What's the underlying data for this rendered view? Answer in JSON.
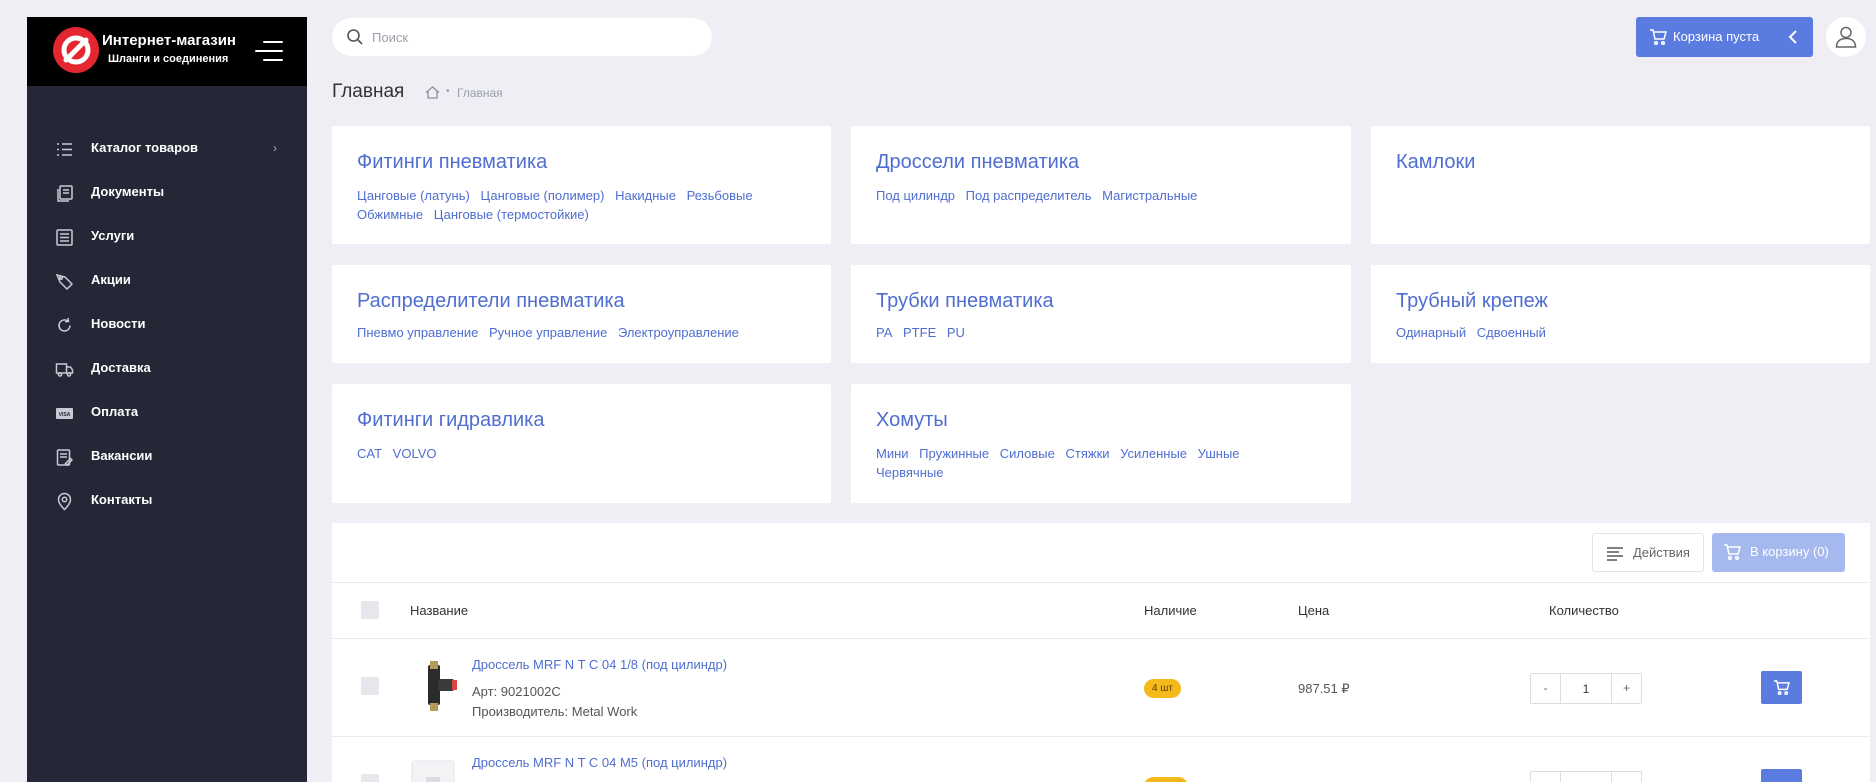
{
  "brand": {
    "title": "Интернет-магазин",
    "subtitle": "Шланги и соединения"
  },
  "nav": [
    {
      "label": "Каталог товаров",
      "icon": "catalog-list-icon"
    },
    {
      "label": "Документы",
      "icon": "documents-icon"
    },
    {
      "label": "Услуги",
      "icon": "services-icon"
    },
    {
      "label": "Акции",
      "icon": "promo-icon"
    },
    {
      "label": "Новости",
      "icon": "news-icon"
    },
    {
      "label": "Доставка",
      "icon": "truck-icon"
    },
    {
      "label": "Оплата",
      "icon": "visa-card-icon"
    },
    {
      "label": "Вакансии",
      "icon": "vacancies-icon"
    },
    {
      "label": "Контакты",
      "icon": "location-pin-icon"
    }
  ],
  "search": {
    "placeholder": "Поиск"
  },
  "header": {
    "cart_label": "Корзина пуста"
  },
  "breadcrumb": {
    "page_title": "Главная",
    "current": "Главная",
    "separator": "•"
  },
  "categories": [
    {
      "title": "Фитинги пневматика",
      "links": [
        "Цанговые (латунь)",
        "Цанговые (полимер)",
        "Накидные",
        "Резьбовые",
        "Обжимные",
        "Цанговые (термостойкие)"
      ]
    },
    {
      "title": "Дроссели пневматика",
      "links": [
        "Под цилиндр",
        "Под распределитель",
        "Магистральные"
      ]
    },
    {
      "title": "Камлоки",
      "links": []
    },
    {
      "title": "Распределители пневматика",
      "links": [
        "Пневмо управление",
        "Ручное управление",
        "Электроуправление"
      ]
    },
    {
      "title": "Трубки пневматика",
      "links": [
        "PA",
        "PTFE",
        "PU"
      ]
    },
    {
      "title": "Трубный крепеж",
      "links": [
        "Одинарный",
        "Сдвоенный"
      ]
    },
    {
      "title": "Фитинги гидравлика",
      "links": [
        "CAT",
        "VOLVO"
      ]
    },
    {
      "title": "Хомуты",
      "links": [
        "Мини",
        "Пружинные",
        "Силовые",
        "Стяжки",
        "Усиленные",
        "Ушные",
        "Червячные"
      ]
    }
  ],
  "toolbar": {
    "actions_label": "Действия",
    "to_cart_label": "В корзину (0)"
  },
  "table": {
    "col_name": "Название",
    "col_stock": "Наличие",
    "col_price": "Цена",
    "col_qty": "Количество"
  },
  "products": [
    {
      "name": "Дроссель MRF N T C 04 1/8 (под цилиндр)",
      "article": "Арт: 9021002C",
      "maker": "Производитель: Metal Work",
      "stock": "4 шт",
      "price": "987.51 ₽",
      "qty": "1",
      "minus": "-",
      "plus": "+"
    },
    {
      "name": "Дроссель MRF N T C 04 M5 (под цилиндр)"
    }
  ],
  "colors": {
    "accent": "#5a7be0",
    "link": "#4f6ed0",
    "sidebar": "#242836",
    "badge": "#f6b91b",
    "logo": "#e3262f"
  }
}
